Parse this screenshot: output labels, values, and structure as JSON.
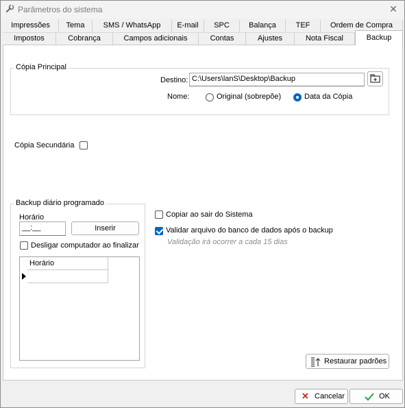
{
  "window": {
    "title": "Parâmetros do sistema"
  },
  "tabs": {
    "row1": [
      "Impressões",
      "Tema",
      "SMS / WhatsApp",
      "E-mail",
      "SPC",
      "Balança",
      "TEF",
      "Ordem de Compra"
    ],
    "row2": [
      "Impostos",
      "Cobrança",
      "Campos adicionais",
      "Contas",
      "Ajustes",
      "Nota Fiscal",
      "Backup"
    ],
    "active": "Backup"
  },
  "primary_copy": {
    "group_label": "Cópia Principal",
    "destination_label": "Destino:",
    "destination_value": "C:\\Users\\lanS\\Desktop\\Backup",
    "name_label": "Nome:",
    "options": [
      {
        "label": "Original (sobrepõe)",
        "selected": false
      },
      {
        "label": "Data da Cópia",
        "selected": true
      }
    ]
  },
  "secondary_copy": {
    "label": "Cópia Secundária",
    "checked": false
  },
  "scheduled": {
    "group_label": "Backup diário programado",
    "time_label": "Horário",
    "time_value": "__:__",
    "insert_button": "Inserir",
    "shutdown_label": "Desligar computador ao finalizar",
    "shutdown_checked": false,
    "grid_header": "Horário"
  },
  "options": {
    "copy_on_exit": {
      "label": "Copiar ao sair do Sistema",
      "checked": false
    },
    "validate_db": {
      "label": "Validar arquivo do banco de dados após o backup",
      "checked": true
    },
    "validation_hint": "Validação irá ocorrer a cada 15 dias"
  },
  "buttons": {
    "restore_defaults": "Restaurar padrões",
    "cancel": "Cancelar",
    "ok": "OK"
  },
  "colors": {
    "accent": "#0067c0",
    "cancel_icon": "#c42b1c",
    "ok_icon": "#2e9e3a"
  }
}
